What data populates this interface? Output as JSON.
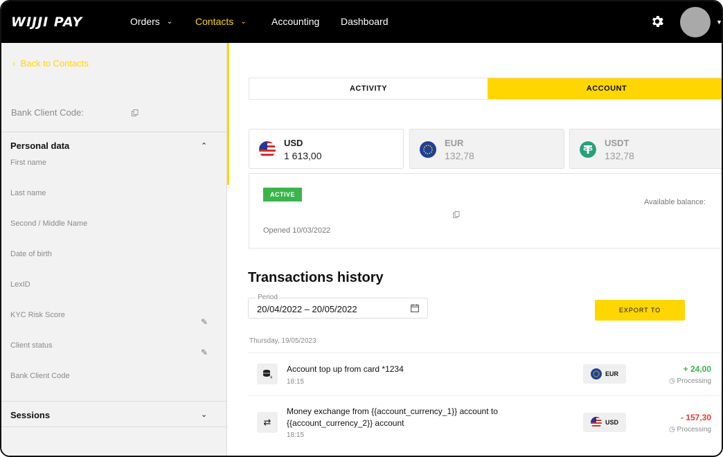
{
  "app": {
    "logo": "WIJJI PAY"
  },
  "nav": {
    "items": [
      {
        "label": "Orders",
        "has_menu": true,
        "active": false
      },
      {
        "label": "Contacts",
        "has_menu": true,
        "active": true
      },
      {
        "label": "Accounting",
        "has_menu": false,
        "active": false
      },
      {
        "label": "Dashboard",
        "has_menu": false,
        "active": false
      }
    ],
    "settings_icon": "gear-icon",
    "avatar_caret": "chevron-down-icon"
  },
  "sidebar": {
    "back_label": "Back to Contacts",
    "bank_client_code_label": "Bank Client Code:",
    "personal_data": {
      "title": "Personal data",
      "fields": [
        "First name",
        "Last name",
        "Second / Middle Name",
        "Date of birth",
        "LexID",
        "KYC Risk Score",
        "Client status",
        "Bank Client Code"
      ]
    },
    "sessions_title": "Sessions"
  },
  "tabs": [
    {
      "label": "ACTIVITY",
      "active": false
    },
    {
      "label": "ACCOUNT",
      "active": true
    }
  ],
  "currencies": [
    {
      "code": "USD",
      "amount": "1 613,00",
      "selected": true,
      "icon": "us-flag-icon"
    },
    {
      "code": "EUR",
      "amount": "132,78",
      "selected": false,
      "icon": "eu-flag-icon"
    },
    {
      "code": "USDT",
      "amount": "132,78",
      "selected": false,
      "icon": "tether-icon"
    }
  ],
  "account": {
    "status": "ACTIVE",
    "opened": "Opened 10/03/2022",
    "available_balance_label": "Available balance:"
  },
  "transactions": {
    "title": "Transactions history",
    "period_label": "Period",
    "period_value": "20/04/2022 – 20/05/2022",
    "export_label": "EXPORT TO",
    "date_heading": "Thursday, 19/05/2023",
    "items": [
      {
        "icon": "coins-icon",
        "description": "Account top up from card *1234",
        "time": "18:15",
        "currency": "EUR",
        "currency_icon": "eu-flag-icon",
        "amount": "+ 24,00",
        "direction": "in",
        "status": "Processing"
      },
      {
        "icon": "exchange-icon",
        "description": "Money exchange from {{account_currency_1}} account to {{account_currency_2}} account",
        "time": "18:15",
        "currency": "USD",
        "currency_icon": "us-flag-icon",
        "amount": "- 157,30",
        "direction": "out",
        "status": "Processing"
      }
    ]
  },
  "colors": {
    "accent": "#ffd600",
    "topbar": "#000000",
    "active_badge": "#3ab54a",
    "positive": "#3ab54a",
    "negative": "#e53935"
  }
}
